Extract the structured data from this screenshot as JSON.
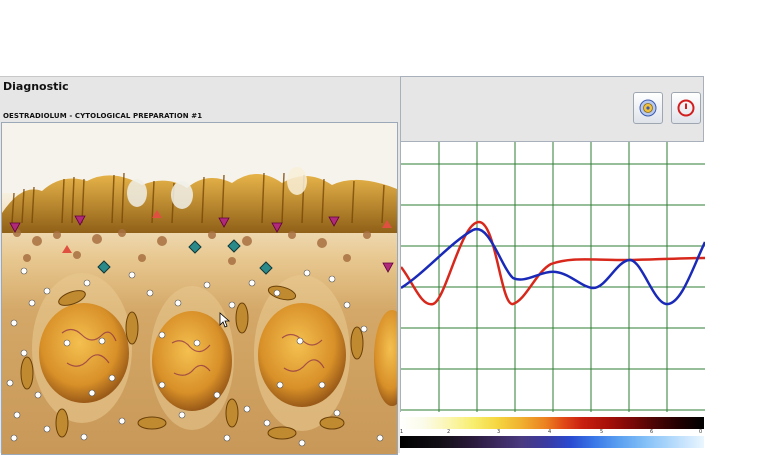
{
  "panel": {
    "title": "Diagnostic",
    "subtitle": "OESTRADIOLUM - CYTOLOGICAL PREPARATION #1"
  },
  "toolbar": {
    "buttons": [
      {
        "name": "scan-button",
        "icon": "scan-disc-icon"
      },
      {
        "name": "stop-button",
        "icon": "power-stop-icon",
        "color": "#d21e1e"
      }
    ]
  },
  "colors": {
    "curve_red": "#d8281c",
    "curve_blue": "#1a2ab8",
    "grid": "#2e7d32",
    "marker_triangle": "#b02a7a",
    "marker_diamond": "#2a8a8a"
  },
  "scale": {
    "ticks": [
      "1",
      "2",
      "3",
      "4",
      "5",
      "6",
      "0"
    ]
  }
}
